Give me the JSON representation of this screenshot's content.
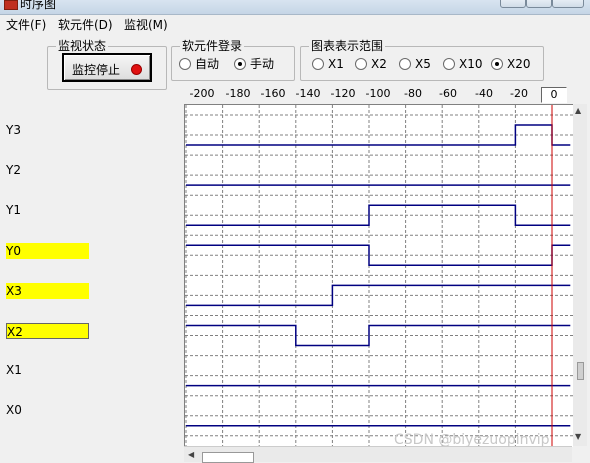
{
  "window": {
    "title": "时序图"
  },
  "menu": [
    "文件(F)",
    "软元件(D)",
    "监视(M)"
  ],
  "monitor": {
    "group_title": "监视状态",
    "button_label": "监控停止",
    "led_color": "#e01010"
  },
  "device_entry": {
    "group_title": "软元件登录",
    "options": [
      "自动",
      "手动"
    ],
    "selected": "手动"
  },
  "range": {
    "group_title": "图表表示范围",
    "options": [
      "X1",
      "X2",
      "X5",
      "X10",
      "X20"
    ],
    "selected": "X20"
  },
  "axis": {
    "ticks": [
      "-200",
      "-180",
      "-160",
      "-140",
      "-120",
      "-100",
      "-80",
      "-60",
      "-40",
      "-20"
    ],
    "current_value": "0"
  },
  "signals": [
    {
      "name": "Y3",
      "highlight": false,
      "selected": false
    },
    {
      "name": "Y2",
      "highlight": false,
      "selected": false
    },
    {
      "name": "Y1",
      "highlight": false,
      "selected": false
    },
    {
      "name": "Y0",
      "highlight": true,
      "selected": false
    },
    {
      "name": "X3",
      "highlight": true,
      "selected": false
    },
    {
      "name": "X2",
      "highlight": true,
      "selected": true
    },
    {
      "name": "X1",
      "highlight": false,
      "selected": false
    },
    {
      "name": "X0",
      "highlight": false,
      "selected": false
    }
  ],
  "chart_data": {
    "type": "line",
    "x_unit_ticks": [
      -200,
      -180,
      -160,
      -140,
      -120,
      -100,
      -80,
      -60,
      -40,
      -20,
      0
    ],
    "xlim": [
      -200,
      10
    ],
    "series": [
      {
        "name": "Y3",
        "segments": [
          [
            -200,
            -20,
            0
          ],
          [
            -20,
            0,
            1
          ],
          [
            0,
            10,
            0
          ]
        ]
      },
      {
        "name": "Y2",
        "segments": [
          [
            -200,
            10,
            0
          ]
        ]
      },
      {
        "name": "Y1",
        "segments": [
          [
            -200,
            -100,
            0
          ],
          [
            -100,
            -20,
            1
          ],
          [
            -20,
            10,
            0
          ]
        ]
      },
      {
        "name": "Y0",
        "segments": [
          [
            -200,
            -100,
            1
          ],
          [
            -100,
            0,
            0
          ],
          [
            0,
            10,
            1
          ]
        ]
      },
      {
        "name": "X3",
        "segments": [
          [
            -200,
            -120,
            0
          ],
          [
            -120,
            10,
            1
          ]
        ]
      },
      {
        "name": "X2",
        "segments": [
          [
            -200,
            -140,
            1
          ],
          [
            -140,
            -100,
            0
          ],
          [
            -100,
            10,
            1
          ]
        ]
      },
      {
        "name": "X1",
        "segments": [
          [
            -200,
            10,
            0
          ]
        ]
      },
      {
        "name": "X0",
        "segments": [
          [
            -200,
            10,
            0
          ]
        ]
      }
    ],
    "cursor_x": 0,
    "wave_color": "#000080",
    "cursor_color": "#cc0000",
    "grid_color": "#808080"
  },
  "watermark": "CSDN @biyezuopinvip"
}
